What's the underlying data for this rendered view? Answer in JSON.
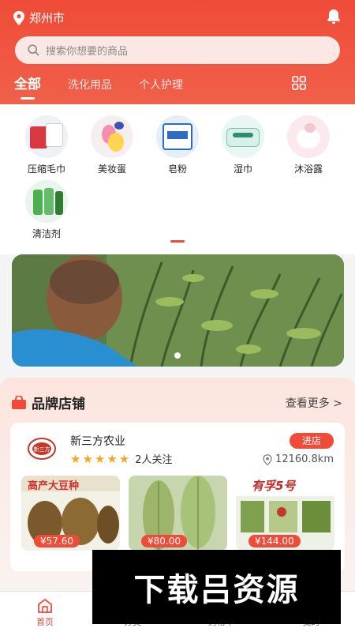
{
  "header": {
    "location": "郑州市",
    "search_placeholder": "搜索你想要的商品",
    "tabs": [
      {
        "label": "全部",
        "active": true
      },
      {
        "label": "洗化用品",
        "active": false
      },
      {
        "label": "个人护理",
        "active": false
      }
    ],
    "accent": "#ef4b38"
  },
  "categories": [
    {
      "label": "压缩毛巾"
    },
    {
      "label": "美妆蛋"
    },
    {
      "label": "皂粉"
    },
    {
      "label": "湿巾"
    },
    {
      "label": "沐浴露"
    },
    {
      "label": "清洁剂"
    }
  ],
  "brand": {
    "title": "品牌店铺",
    "more": "查看更多 >",
    "shop": {
      "name": "新三方农业",
      "stars": 5,
      "followers": "2人关注",
      "enter": "进店",
      "distance": "12160.8km",
      "logo_text": "新三方"
    },
    "products": [
      {
        "price": "¥57.60",
        "overlay": "高产大豆种"
      },
      {
        "price": "¥80.00",
        "overlay": ""
      },
      {
        "price": "¥144.00",
        "overlay": "有孚5号"
      }
    ]
  },
  "bottom_nav": [
    {
      "label": "首页",
      "active": true
    },
    {
      "label": "分类",
      "active": false
    },
    {
      "label": "购物车",
      "active": false
    },
    {
      "label": "我的",
      "active": false
    }
  ],
  "watermark": "下载吕资源"
}
